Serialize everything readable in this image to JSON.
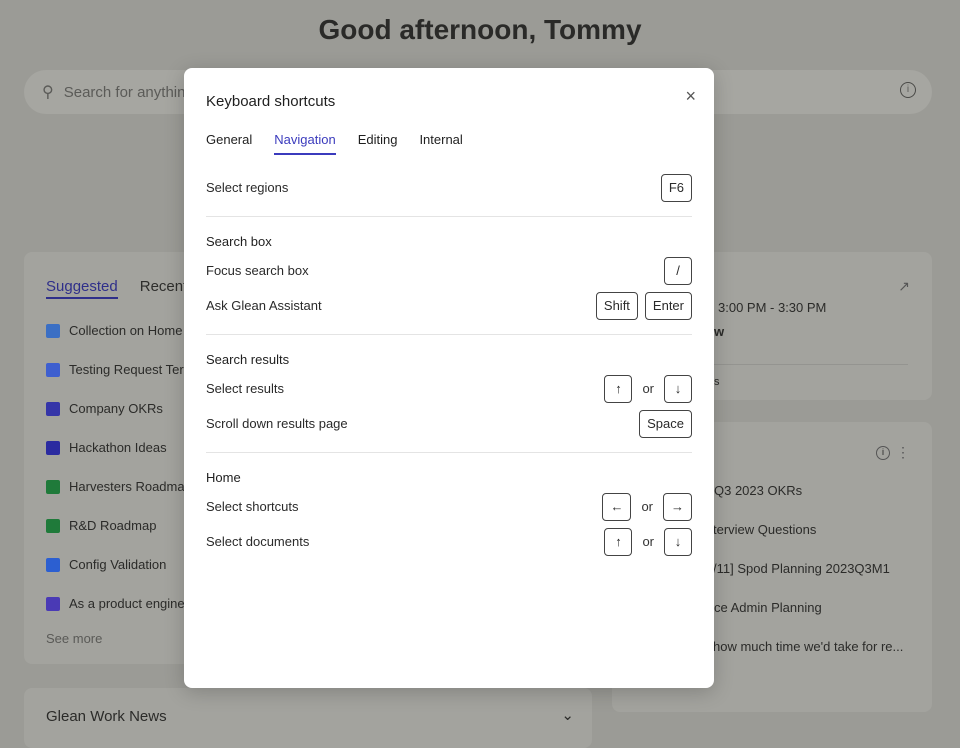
{
  "greeting": "Good afternoon, Tommy",
  "search": {
    "placeholder": "Search for anythin"
  },
  "suggested": {
    "tabs": [
      "Suggested",
      "Recent"
    ],
    "items": [
      {
        "label": "Collection on Home",
        "color": "#3b6fc4"
      },
      {
        "label": "Testing Request Ter",
        "color": "#3e5fcf"
      },
      {
        "label": "Company OKRs",
        "color": "#3535a8"
      },
      {
        "label": "Hackathon Ideas",
        "color": "#2b2ba0"
      },
      {
        "label": "Harvesters Roadma",
        "color": "#1f7a3a"
      },
      {
        "label": "R&D Roadmap",
        "color": "#1f7a3a"
      },
      {
        "label": "Config Validation",
        "color": "#2c5fd1"
      },
      {
        "label": "As a product engine",
        "color": "#4a3ab5"
      }
    ],
    "see_more": "See more"
  },
  "news": {
    "title": "Glean Work News"
  },
  "calendar": {
    "time": "3:00 PM - 3:30 PM",
    "line2": "w",
    "line3": "s"
  },
  "docs": {
    "items": [
      "Q3 2023 OKRs",
      "terview Questions",
      "/11] Spod Planning 2023Q3M1",
      "ce Admin Planning",
      "how much time we'd take for re..."
    ]
  },
  "modal": {
    "title": "Keyboard shortcuts",
    "close": "×",
    "tabs": [
      "General",
      "Navigation",
      "Editing",
      "Internal"
    ],
    "active_tab": "Navigation",
    "or": "or",
    "top": {
      "label": "Select regions",
      "keys": [
        "F6"
      ]
    },
    "sections": [
      {
        "title": "Search box",
        "rows": [
          {
            "label": "Focus search box",
            "keys": [
              "/"
            ]
          },
          {
            "label": "Ask Glean Assistant",
            "keys": [
              "Shift",
              "Enter"
            ]
          }
        ]
      },
      {
        "title": "Search results",
        "rows": [
          {
            "label": "Select results",
            "keys": [
              "↑",
              "↓"
            ],
            "alt": true
          },
          {
            "label": "Scroll down results page",
            "keys": [
              "Space"
            ]
          }
        ]
      },
      {
        "title": "Home",
        "rows": [
          {
            "label": "Select shortcuts",
            "keys": [
              "←",
              "→"
            ],
            "alt": true
          },
          {
            "label": "Select documents",
            "keys": [
              "↑",
              "↓"
            ],
            "alt": true
          }
        ]
      }
    ]
  }
}
